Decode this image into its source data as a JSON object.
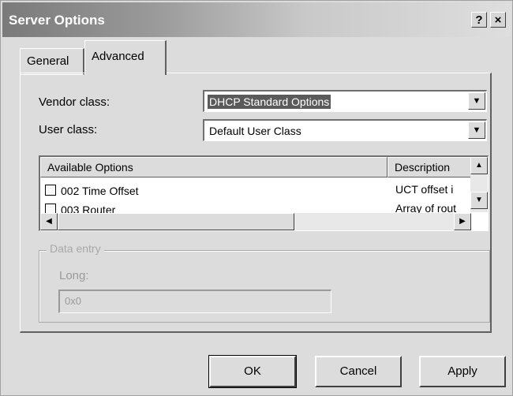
{
  "window": {
    "title": "Server Options",
    "help_label": "?",
    "close_label": "×"
  },
  "tabs": [
    {
      "label": "General",
      "active": false
    },
    {
      "label": "Advanced",
      "active": true
    }
  ],
  "vendor_class": {
    "label": "Vendor class:",
    "value": "DHCP Standard Options"
  },
  "user_class": {
    "label": "User class:",
    "value": "Default User Class"
  },
  "options_list": {
    "columns": [
      "Available Options",
      "Description"
    ],
    "rows": [
      {
        "option": "002 Time Offset",
        "description": "UCT offset i",
        "checked": false
      },
      {
        "option": "003 Router",
        "description": "Array of rout",
        "checked": false
      }
    ]
  },
  "data_entry": {
    "group_label": "Data entry",
    "long_label": "Long:",
    "long_value": "0x0"
  },
  "buttons": {
    "ok": "OK",
    "cancel": "Cancel",
    "apply": "Apply"
  }
}
